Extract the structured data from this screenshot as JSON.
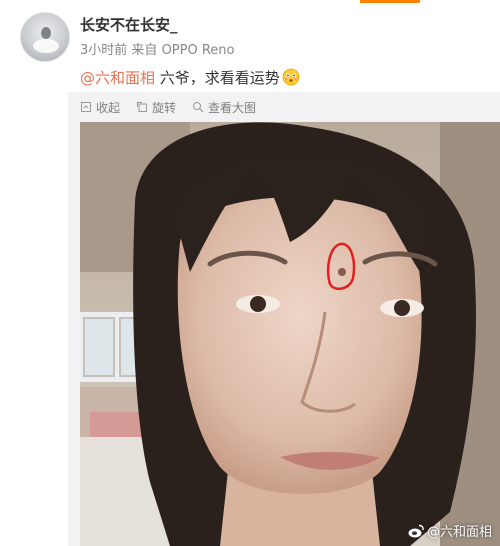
{
  "post": {
    "username": "长安不在长安_",
    "time": "3小时前",
    "source_prefix": "来自",
    "source": "OPPO Reno",
    "mention": "@六和面相",
    "text": " 六爷，求看看运势",
    "emoji": "flushed-face-emoji"
  },
  "toolbar": {
    "collapse_label": "收起",
    "rotate_label": "旋转",
    "view_large_label": "查看大图"
  },
  "photo": {
    "watermark": "@六和面相",
    "annotation_color": "#e02020"
  },
  "colors": {
    "brand_orange": "#ff8200",
    "link": "#eb7350",
    "muted": "#808080",
    "panel": "#f2f2f5"
  }
}
